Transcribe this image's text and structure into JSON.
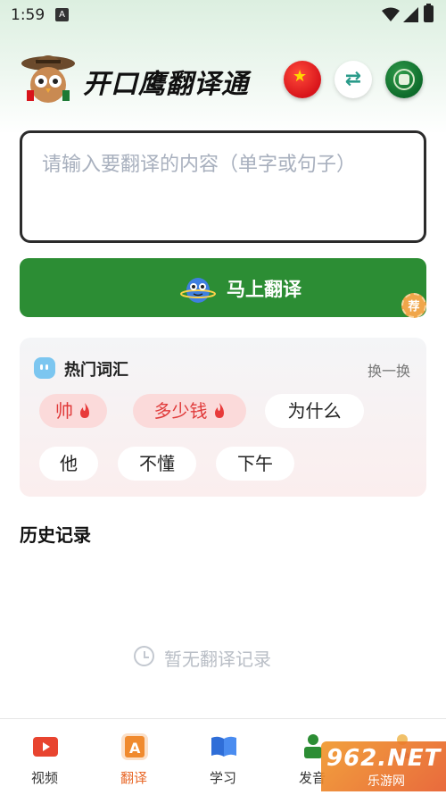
{
  "status_bar": {
    "time": "1:59",
    "notification_icon": "A"
  },
  "header": {
    "title": "开口鹰翻译通",
    "source_flag_icon": "china-flag-icon",
    "swap_icon": "swap-arrows-icon",
    "target_flag_icon": "arabic-flag-icon",
    "swap_symbol": "⇄"
  },
  "input": {
    "placeholder": "请输入要翻译的内容（单字或句子）",
    "value": ""
  },
  "translate_button": {
    "label": "马上翻译",
    "badge": "荐"
  },
  "hot_words": {
    "title": "热门词汇",
    "refresh_label": "换一换",
    "chips": [
      {
        "label": "帅",
        "hot": true
      },
      {
        "label": "多少钱",
        "hot": true
      },
      {
        "label": "为什么",
        "hot": false
      },
      {
        "label": "他",
        "hot": false
      },
      {
        "label": "不懂",
        "hot": false
      },
      {
        "label": "下午",
        "hot": false
      }
    ]
  },
  "history": {
    "title": "历史记录",
    "empty_text": "暂无翻译记录"
  },
  "bottom_nav": {
    "items": [
      {
        "label": "视频",
        "icon": "video-play-icon",
        "active": false
      },
      {
        "label": "翻译",
        "icon": "translate-icon",
        "active": true
      },
      {
        "label": "学习",
        "icon": "book-icon",
        "active": false
      },
      {
        "label": "发音",
        "icon": "pronunciation-icon",
        "active": false
      },
      {
        "label": "",
        "icon": "profile-icon",
        "active": false
      }
    ]
  },
  "watermark": {
    "main": "962.NET",
    "sub": "乐游网"
  },
  "colors": {
    "primary_green": "#2c8d34",
    "active_orange": "#e8692a",
    "hot_red": "#e03a3a"
  }
}
